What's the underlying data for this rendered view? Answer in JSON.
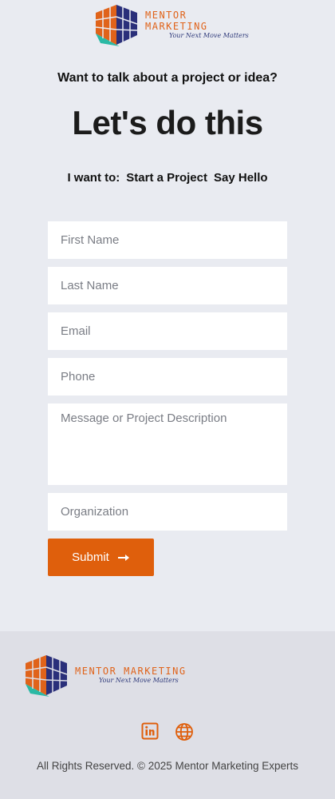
{
  "brand": {
    "name": "MENTOR MARKETING",
    "tagline": "Your Next Move Matters",
    "colors": {
      "accent": "#df5f0c",
      "navy": "#2a2f7a",
      "teal": "#2bb9a5"
    }
  },
  "hero": {
    "subtitle": "Want to talk about a project or idea?",
    "headline": "Let's do this"
  },
  "intent": {
    "label": "I want to:",
    "options": [
      "Start a Project",
      "Say Hello"
    ]
  },
  "form": {
    "first_name_placeholder": "First Name",
    "last_name_placeholder": "Last Name",
    "email_placeholder": "Email",
    "phone_placeholder": "Phone",
    "message_placeholder": "Message or Project Description",
    "organization_placeholder": "Organization",
    "submit_label": "Submit"
  },
  "footer": {
    "social_icons": [
      "linkedin-icon",
      "globe-icon"
    ],
    "copyright": "All Rights Reserved. © 2025 Mentor Marketing Experts"
  }
}
